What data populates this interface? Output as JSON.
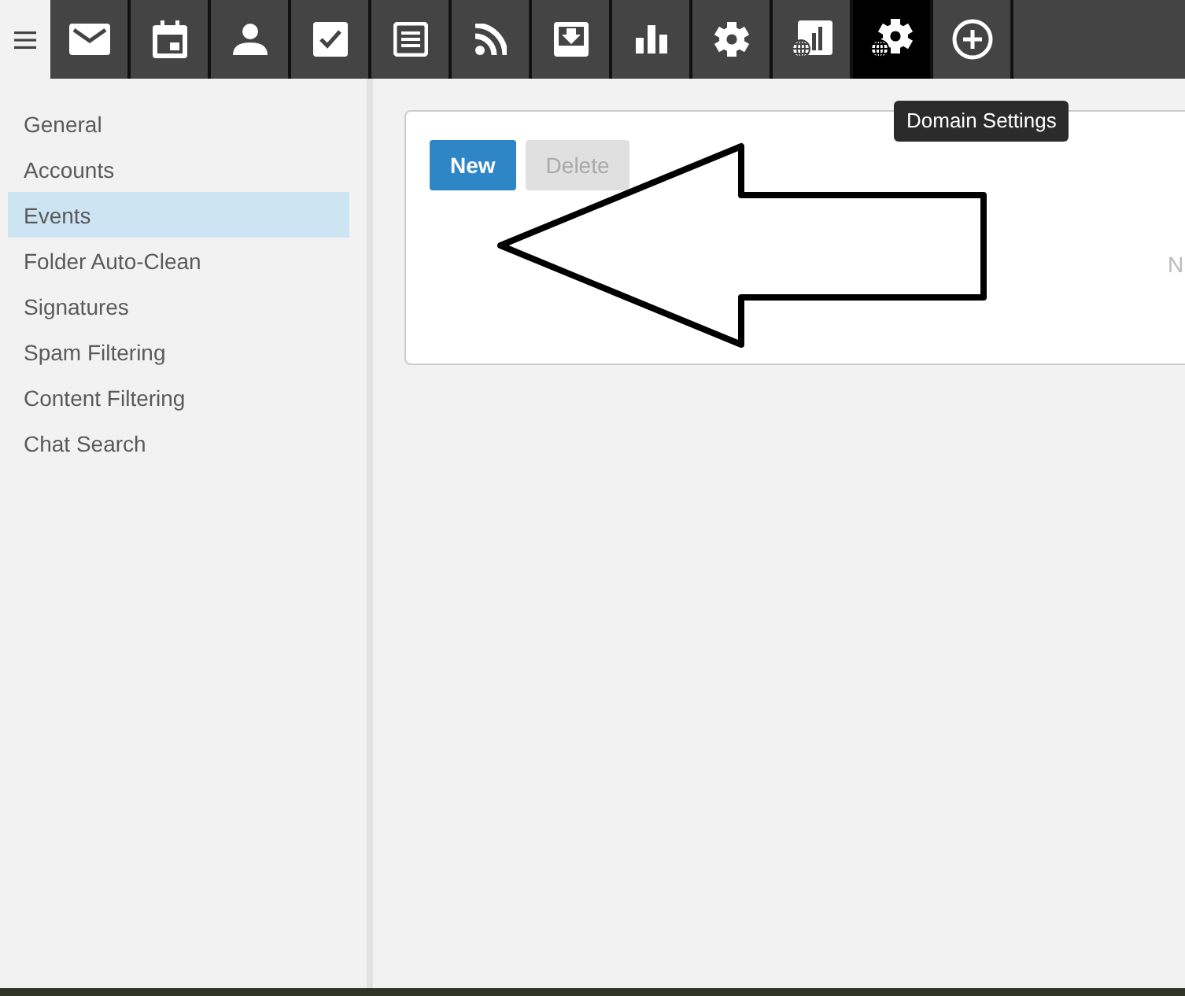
{
  "toolbar": {
    "items": [
      {
        "selected": false
      },
      {
        "selected": false
      },
      {
        "selected": false
      },
      {
        "selected": false
      },
      {
        "selected": false
      },
      {
        "selected": false
      },
      {
        "selected": false
      },
      {
        "selected": false
      },
      {
        "selected": false
      },
      {
        "selected": false
      },
      {
        "selected": true
      },
      {
        "selected": false
      }
    ]
  },
  "tooltip": {
    "text": "Domain Settings"
  },
  "sidebar": {
    "items": [
      {
        "label": "General",
        "selected": false
      },
      {
        "label": "Accounts",
        "selected": false
      },
      {
        "label": "Events",
        "selected": true
      },
      {
        "label": "Folder Auto-Clean",
        "selected": false
      },
      {
        "label": "Signatures",
        "selected": false
      },
      {
        "label": "Spam Filtering",
        "selected": false
      },
      {
        "label": "Content Filtering",
        "selected": false
      },
      {
        "label": "Chat Search",
        "selected": false
      }
    ]
  },
  "buttons": [
    {
      "label": "New",
      "disabled": false
    },
    {
      "label": "Delete",
      "disabled": true
    }
  ],
  "panel": {
    "column_1": "N"
  }
}
